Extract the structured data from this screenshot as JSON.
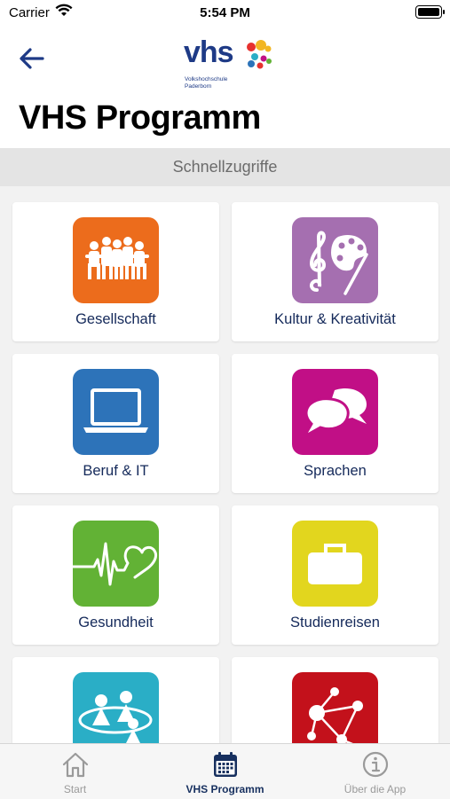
{
  "status_bar": {
    "carrier": "Carrier",
    "time": "5:54 PM"
  },
  "header": {
    "logo_text": "vhs",
    "logo_sub1": "Volkshochschule",
    "logo_sub2": "Paderborn",
    "title": "VHS Programm"
  },
  "section": {
    "title": "Schnellzugriffe"
  },
  "tiles": [
    {
      "label": "Gesellschaft",
      "color": "#ec6c1c",
      "icon": "people-chain-icon"
    },
    {
      "label": "Kultur & Kreativität",
      "color": "#a56fb0",
      "icon": "music-palette-icon"
    },
    {
      "label": "Beruf & IT",
      "color": "#2d73b9",
      "icon": "laptop-icon"
    },
    {
      "label": "Sprachen",
      "color": "#c10f86",
      "icon": "speech-bubbles-icon"
    },
    {
      "label": "Gesundheit",
      "color": "#62b235",
      "icon": "heartbeat-icon"
    },
    {
      "label": "Studienreisen",
      "color": "#e2d61e",
      "icon": "suitcase-icon"
    },
    {
      "label": "",
      "color": "#2aaec6",
      "icon": "group-circle-icon"
    },
    {
      "label": "",
      "color": "#c3111b",
      "icon": "network-icon"
    }
  ],
  "tabbar": {
    "items": [
      {
        "label": "Start",
        "icon": "home-icon"
      },
      {
        "label": "VHS Programm",
        "icon": "calendar-icon"
      },
      {
        "label": "Über die App",
        "icon": "info-icon"
      }
    ],
    "active_index": 1
  }
}
